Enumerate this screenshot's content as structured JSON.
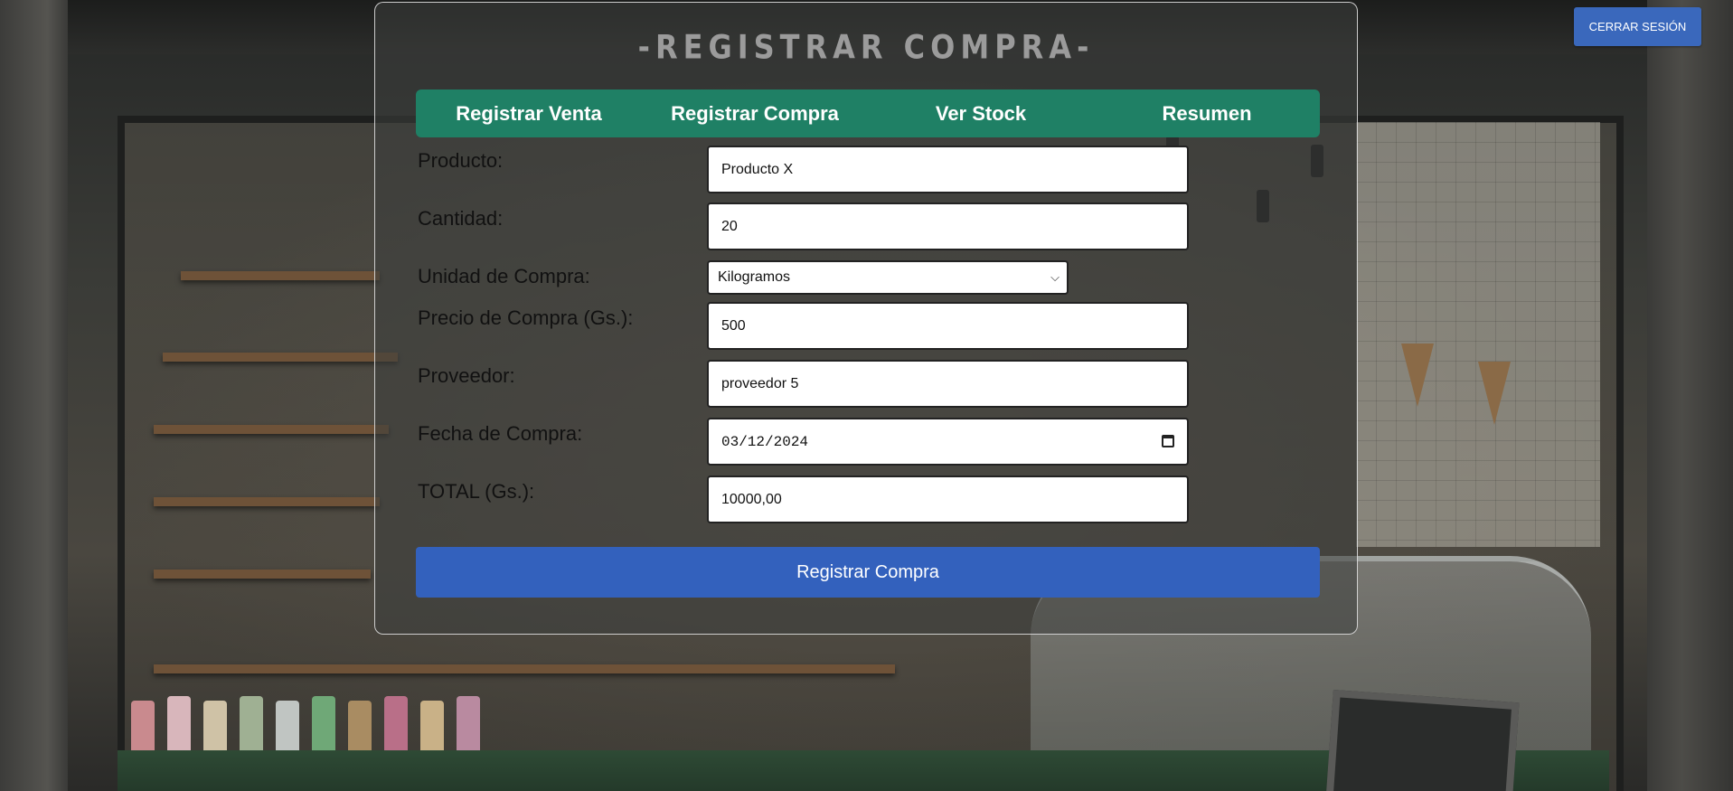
{
  "page": {
    "title": "-REGISTRAR COMPRA-",
    "logout_label": "CERRAR SESIÓN"
  },
  "nav": {
    "items": [
      {
        "label": "Registrar Venta"
      },
      {
        "label": "Registrar Compra"
      },
      {
        "label": "Ver Stock"
      },
      {
        "label": "Resumen"
      }
    ]
  },
  "form": {
    "producto": {
      "label": "Producto:",
      "value": "Producto X"
    },
    "cantidad": {
      "label": "Cantidad:",
      "value": "20"
    },
    "unidad": {
      "label": "Unidad de Compra:",
      "value": "Kilogramos"
    },
    "precio": {
      "label": "Precio de Compra (Gs.):",
      "value": "500"
    },
    "proveedor": {
      "label": "Proveedor:",
      "value": "proveedor 5"
    },
    "fecha": {
      "label": "Fecha de Compra:",
      "value": "03/12/2024"
    },
    "total": {
      "label": "TOTAL (Gs.):",
      "value": "10000,00"
    },
    "submit_label": "Registrar Compra"
  },
  "colors": {
    "nav_bg": "#1f8065",
    "submit_bg": "#3361bd",
    "logout_bg": "#3a68bc"
  },
  "icons": {
    "select_arrow": "chevron-down-icon",
    "date_picker": "calendar-icon"
  }
}
